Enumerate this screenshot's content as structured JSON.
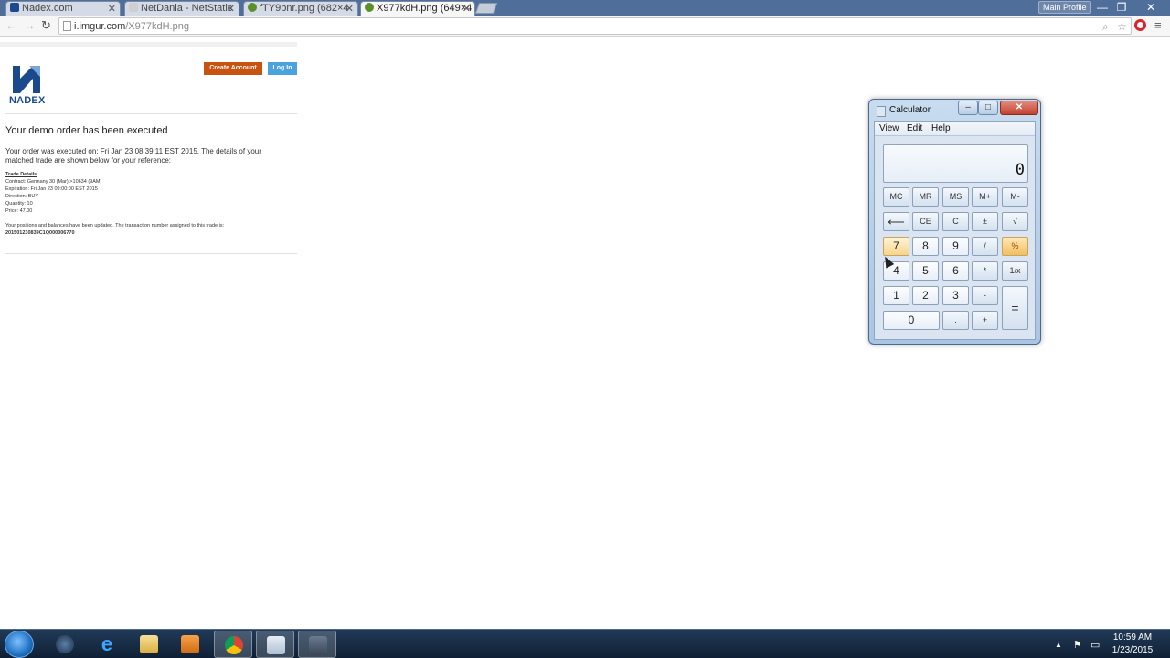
{
  "browser": {
    "tabs": [
      {
        "title": "Nadex.com",
        "favicon_color": "#1b4a8c",
        "active": false
      },
      {
        "title": "NetDania - NetStatic",
        "favicon_color": "#cfcfcf",
        "active": false
      },
      {
        "title": "fTY9bnr.png (682×4",
        "favicon_color": "#5a8f2a",
        "active": false
      },
      {
        "title": "X977kdH.png (649×4",
        "favicon_color": "#5a8f2a",
        "active": true
      }
    ],
    "profile_label": "Main Profile",
    "url_host": "i.imgur.com",
    "url_path": "/X977kdH.png"
  },
  "email": {
    "logo_text": "NADEX",
    "create_account_label": "Create Account",
    "login_label": "Log In",
    "heading": "Your demo order has been executed",
    "body_line1": "Your order was executed on: Fri Jan 23 08:39:11 EST 2015. The details of your",
    "body_line2": "matched trade are shown below for your reference:",
    "trade_details_label": "Trade Details",
    "contract": "Contract: Germany 30 (Mar) >10634 (9AM)",
    "expiration": "Expiration: Fri Jan 23 09:00:00 EST 2015",
    "direction": "Direction: BUY",
    "quantity": "Quantity: 10",
    "price": "Price: 47.00",
    "updated_line": "Your positions and balances have been updated. The transaction number assigned to this trade is:",
    "transaction_number": "201501230839C1Q000006770"
  },
  "calculator": {
    "title": "Calculator",
    "menu": [
      "View",
      "Edit",
      "Help"
    ],
    "display": "0",
    "keys": {
      "mc": "MC",
      "mr": "MR",
      "ms": "MS",
      "mplus": "M+",
      "mminus": "M-",
      "back": "⟵",
      "ce": "CE",
      "c": "C",
      "plusminus": "±",
      "sqrt": "√",
      "n7": "7",
      "n8": "8",
      "n9": "9",
      "div": "/",
      "pct": "%",
      "n4": "4",
      "n5": "5",
      "n6": "6",
      "mul": "*",
      "recip": "1/x",
      "n1": "1",
      "n2": "2",
      "n3": "3",
      "sub": "-",
      "eq": "=",
      "n0": "0",
      "dot": ".",
      "add": "+"
    }
  },
  "taskbar": {
    "time": "10:59 AM",
    "date": "1/23/2015"
  }
}
